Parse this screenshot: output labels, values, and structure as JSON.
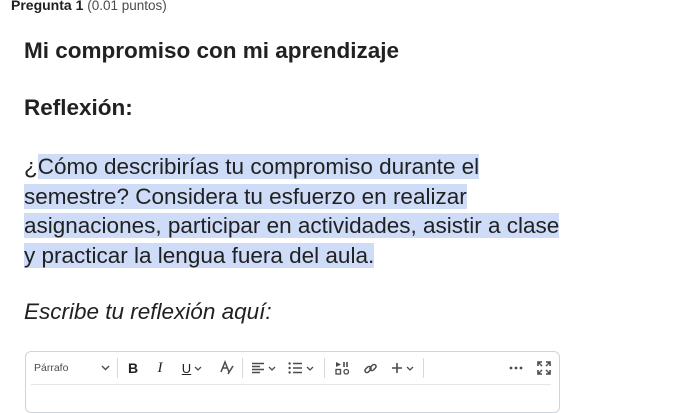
{
  "question": {
    "number_label": "Pregunta 1",
    "points_label": "(0.01 puntos)"
  },
  "content": {
    "title": "Mi compromiso con mi aprendizaje",
    "subtitle": "Reflexión:",
    "prompt_lead": "¿",
    "prompt_selected": "Cómo describirías tu compromiso durante el semestre? Considera tu esfuerzo en realizar asignaciones, participar en actividades, asistir a clase y practicar la lengua fuera del aula.",
    "instruction": "Escribe tu reflexión aquí:"
  },
  "editor": {
    "format_select": "Párrafo",
    "icons": {
      "bold": "B",
      "italic": "I",
      "underline": "U"
    }
  },
  "colors": {
    "selection": "#cfdcf7",
    "border": "#cdd5dc"
  }
}
